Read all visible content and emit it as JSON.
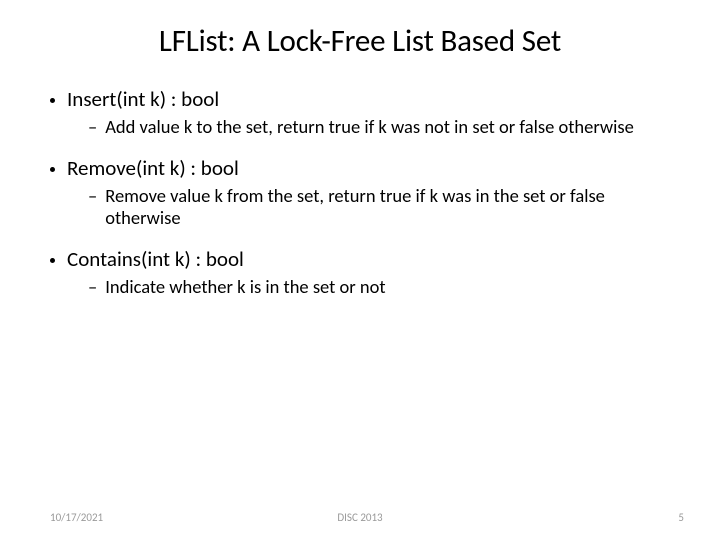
{
  "title": "LFList: A Lock-Free List Based Set",
  "items": [
    {
      "label": "Insert(int k) : bool",
      "sub": "Add value k to the set, return true if k was not in set or false otherwise"
    },
    {
      "label": "Remove(int k) : bool",
      "sub": "Remove value k from the set, return true if k was in the set or false otherwise"
    },
    {
      "label": "Contains(int k) : bool",
      "sub": "Indicate whether k is in the set or not"
    }
  ],
  "footer": {
    "date": "10/17/2021",
    "venue": "DISC 2013",
    "page": "5"
  }
}
